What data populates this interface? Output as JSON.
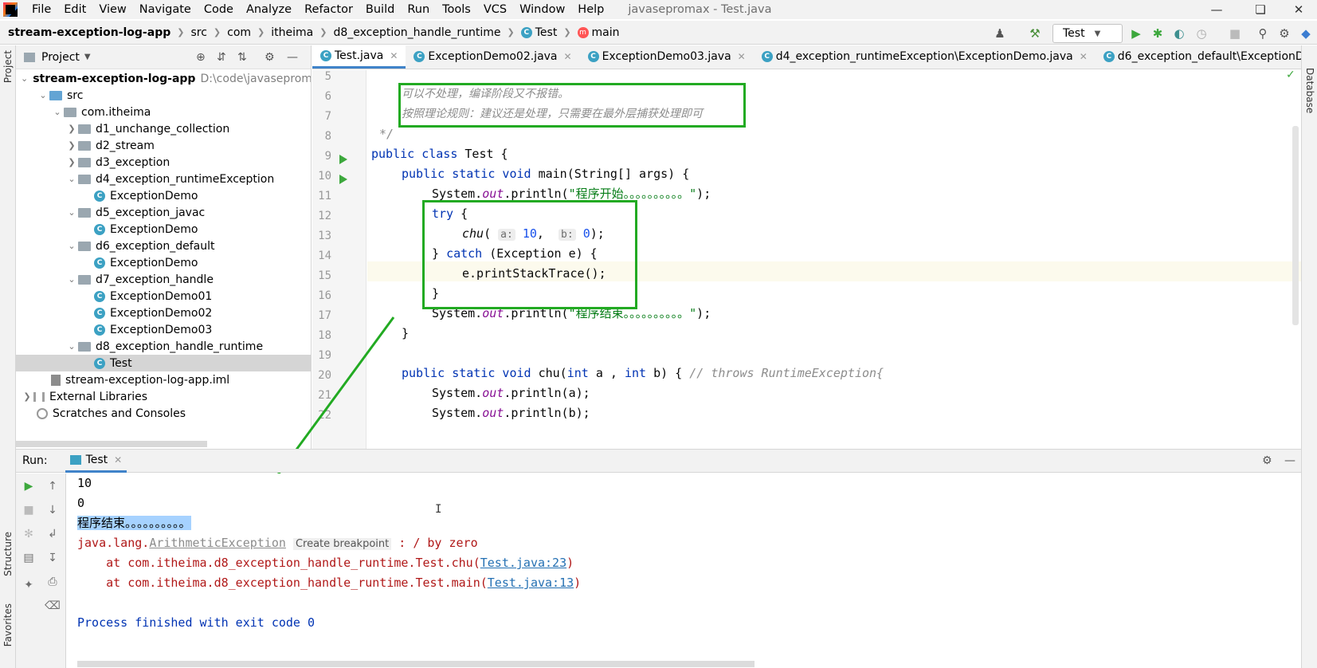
{
  "menubar": {
    "items": [
      "File",
      "Edit",
      "View",
      "Navigate",
      "Code",
      "Analyze",
      "Refactor",
      "Build",
      "Run",
      "Tools",
      "VCS",
      "Window",
      "Help"
    ],
    "title": "javasepromax - Test.java"
  },
  "navbar": {
    "crumbs": [
      "stream-exception-log-app",
      "src",
      "com",
      "itheima",
      "d8_exception_handle_runtime",
      "Test",
      "main"
    ],
    "run_config": "Test"
  },
  "project": {
    "title": "Project",
    "root_name": "stream-exception-log-app",
    "root_path": "D:\\code\\javasepromax\\",
    "tree": [
      {
        "label": "src",
        "level": 1
      },
      {
        "label": "com.itheima",
        "level": 2
      },
      {
        "label": "d1_unchange_collection",
        "level": 3
      },
      {
        "label": "d2_stream",
        "level": 3
      },
      {
        "label": "d3_exception",
        "level": 3
      },
      {
        "label": "d4_exception_runtimeException",
        "level": 3
      },
      {
        "label": "ExceptionDemo",
        "level": 4
      },
      {
        "label": "d5_exception_javac",
        "level": 3
      },
      {
        "label": "ExceptionDemo",
        "level": 4
      },
      {
        "label": "d6_exception_default",
        "level": 3
      },
      {
        "label": "ExceptionDemo",
        "level": 4
      },
      {
        "label": "d7_exception_handle",
        "level": 3
      },
      {
        "label": "ExceptionDemo01",
        "level": 4
      },
      {
        "label": "ExceptionDemo02",
        "level": 4
      },
      {
        "label": "ExceptionDemo03",
        "level": 4
      },
      {
        "label": "d8_exception_handle_runtime",
        "level": 3
      },
      {
        "label": "Test",
        "level": 4
      },
      {
        "label": "stream-exception-log-app.iml",
        "level": 2
      },
      {
        "label": "External Libraries",
        "level": 0
      },
      {
        "label": "Scratches and Consoles",
        "level": 0
      }
    ]
  },
  "tabs": [
    "Test.java",
    "ExceptionDemo02.java",
    "ExceptionDemo03.java",
    "d4_exception_runtimeException\\ExceptionDemo.java",
    "d6_exception_default\\ExceptionDemo.java"
  ],
  "editor": {
    "line_numbers": [
      "5",
      "6",
      "7",
      "8",
      "9",
      "10",
      "11",
      "12",
      "13",
      "14",
      "15",
      "16",
      "17",
      "18",
      "19",
      "20",
      "21",
      "22"
    ],
    "comment1": "可以不处理，编译阶段又不报错。",
    "comment2": "按照理论规则：建议还是处理，只需要在最外层捕获处理即可",
    "comment_end": "*/",
    "line9": {
      "kw": "public class",
      "rest": " Test {"
    },
    "line10": {
      "kw": "public static void",
      "rest": " main(String[] args) {"
    },
    "line11": {
      "pre": "System.",
      "field": "out",
      "mid": ".println(",
      "str": "\"程序开始。。。。。。。。。。\"",
      "post": ");"
    },
    "line12": {
      "kw": "try",
      "rest": " {"
    },
    "line13": {
      "method": "chu",
      "hint_a": "a:",
      "arg_a": "10",
      "hint_b": "b:",
      "arg_b": "0",
      "post": ");"
    },
    "line14": {
      "pre": "} ",
      "kw": "catch",
      "rest": " (Exception e) {"
    },
    "line15": "e.printStackTrace();",
    "line16": "}",
    "line17": {
      "pre": "System.",
      "field": "out",
      "mid": ".println(",
      "str": "\"程序结束。。。。。。。。。。\"",
      "post": ");"
    },
    "line18": "}",
    "line20": {
      "kw": "public static void",
      "name": " chu(",
      "kw2": "int",
      "mid": " a , ",
      "kw3": "int",
      "rest": " b) { ",
      "cmt": "// throws RuntimeException{"
    },
    "line21": {
      "pre": "System.",
      "field": "out",
      "post": ".println(a);"
    },
    "line22": {
      "pre": "System.",
      "field": "out",
      "post": ".println(b);"
    }
  },
  "run": {
    "label": "Run:",
    "tab": "Test",
    "output": {
      "l1": "10",
      "l2": "0",
      "l3": "程序结束。。。。。。。。。。",
      "exc_pre": "java.lang.",
      "exc_name": "ArithmeticException",
      "breakpoint": "Create breakpoint",
      "exc_msg": " : / by zero",
      "at1_pre": "    at com.itheima.d8_exception_handle_runtime.Test.chu(",
      "at1_link": "Test.java:23",
      "at2_pre": "    at com.itheima.d8_exception_handle_runtime.Test.main(",
      "at2_link": "Test.java:13",
      "close": ")",
      "finish": "Process finished with exit code 0"
    }
  },
  "strips": {
    "left_project": "Project",
    "left_structure": "Structure",
    "left_favorites": "Favorites",
    "right_database": "Database"
  }
}
